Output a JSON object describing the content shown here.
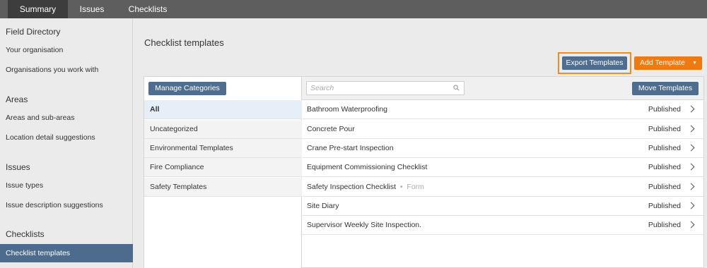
{
  "tabs": [
    {
      "label": "Summary",
      "active": true
    },
    {
      "label": "Issues",
      "active": false
    },
    {
      "label": "Checklists",
      "active": false
    }
  ],
  "sidebar": {
    "sections": [
      {
        "heading": "Field Directory",
        "items": [
          "Your organisation",
          "Organisations you work with"
        ]
      },
      {
        "heading": "Areas",
        "items": [
          "Areas and sub-areas",
          "Location detail suggestions"
        ]
      },
      {
        "heading": "Issues",
        "items": [
          "Issue types",
          "Issue description suggestions"
        ]
      },
      {
        "heading": "Checklists",
        "items": [
          "Checklist templates"
        ]
      }
    ],
    "active_item": "Checklist templates"
  },
  "main": {
    "title": "Checklist templates",
    "export_label": "Export Templates",
    "add_label": "Add Template",
    "manage_categories_label": "Manage Categories",
    "move_templates_label": "Move Templates",
    "search_placeholder": "Search",
    "categories": [
      "All",
      "Uncategorized",
      "Environmental Templates",
      "Fire Compliance",
      "Safety Templates"
    ],
    "active_category": "All",
    "templates": [
      {
        "name": "Bathroom Waterproofing",
        "type": "",
        "status": "Published"
      },
      {
        "name": "Concrete Pour",
        "type": "",
        "status": "Published"
      },
      {
        "name": "Crane Pre-start Inspection",
        "type": "",
        "status": "Published"
      },
      {
        "name": "Equipment Commissioning Checklist",
        "type": "",
        "status": "Published"
      },
      {
        "name": "Safety Inspection Checklist",
        "type": "Form",
        "status": "Published"
      },
      {
        "name": "Site Diary",
        "type": "",
        "status": "Published"
      },
      {
        "name": "Supervisor Weekly Site Inspection.",
        "type": "",
        "status": "Published"
      }
    ]
  },
  "colors": {
    "accent_blue": "#4f6d8e",
    "accent_orange": "#f07a12",
    "highlight_border": "#f28b22",
    "active_sidebar": "#4d6c8d"
  }
}
